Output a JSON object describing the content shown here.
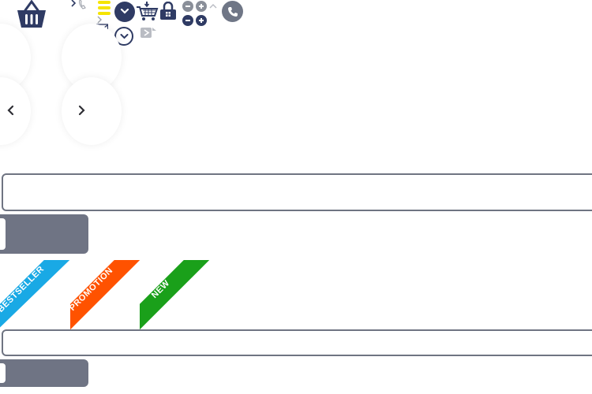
{
  "icons": {
    "basket": "basket-icon",
    "chevron_small": "chevron-right-icon",
    "phone_small": "phone-small-icon",
    "mail": "envelope-icon",
    "menu": "hamburger-menu-icon",
    "dropdown_filled": "chevron-down-icon",
    "dropdown_outline": "chevron-down-outline-icon",
    "cart": "shopping-cart-icon",
    "lock": "lock-icon",
    "play_small": "play-arrow-icon",
    "minus": "minus-icon",
    "plus": "plus-icon",
    "chevron_up": "chevron-up-icon",
    "phone": "phone-icon",
    "arrow_left": "arrow-left-icon",
    "arrow_right": "arrow-right-icon"
  },
  "colors": {
    "navy": "#2f3b64",
    "gray": "#6f7484",
    "yellow": "#f5e400",
    "ribbon_bestseller": "#19a9e5",
    "ribbon_promotion": "#ff5200",
    "ribbon_new": "#1aa01a"
  },
  "form": {
    "input_value": "",
    "input_placeholder": "",
    "button_label": "",
    "input2_value": "",
    "input2_placeholder": "",
    "button2_label": ""
  },
  "badges": {
    "bestseller": "BESTSELLER",
    "promotion": "PROMOTION",
    "new": "NEW"
  }
}
